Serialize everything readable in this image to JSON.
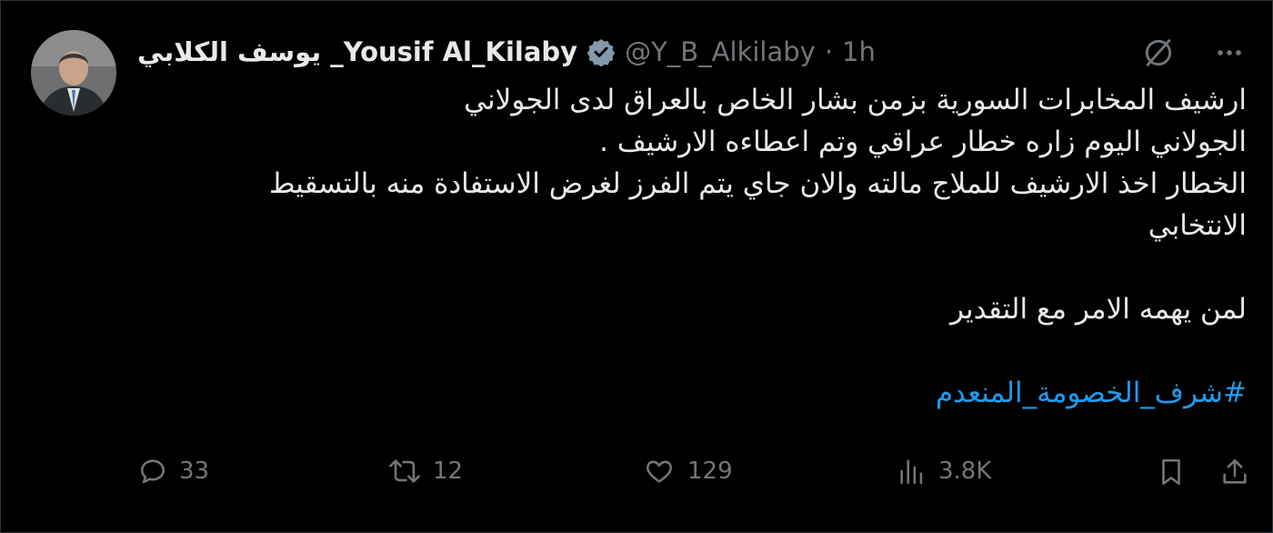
{
  "tweet": {
    "display_name": "يوسف الكلابي _Yousif Al_Kilaby",
    "handle": "@Y_B_Alkilaby",
    "separator": "·",
    "time": "1h",
    "lines": [
      "ارشيف المخابرات السورية بزمن بشار الخاص بالعراق لدى الجولاني",
      "الجولاني اليوم زاره خطار عراقي وتم اعطاءه الارشيف .",
      "الخطار اخذ الارشيف للملاج مالته والان جاي يتم الفرز  لغرض الاستفادة منه بالتسقيط",
      "الانتخابي"
    ],
    "closing_line": "لمن يهمه الامر مع التقدير",
    "hashtag": "#شرف_الخصومة_المنعدم"
  },
  "actions": {
    "replies": "33",
    "reposts": "12",
    "likes": "129",
    "views": "3.8K"
  },
  "icons": {
    "verified": "verified-badge-icon",
    "grok": "grok-icon",
    "more": "more-icon",
    "reply": "reply-icon",
    "repost": "repost-icon",
    "like": "like-icon",
    "views": "views-icon",
    "bookmark": "bookmark-icon",
    "share": "share-icon"
  },
  "colors": {
    "background": "#000000",
    "text": "#e7e9ea",
    "muted": "#71767b",
    "accent": "#1d9bf0"
  }
}
